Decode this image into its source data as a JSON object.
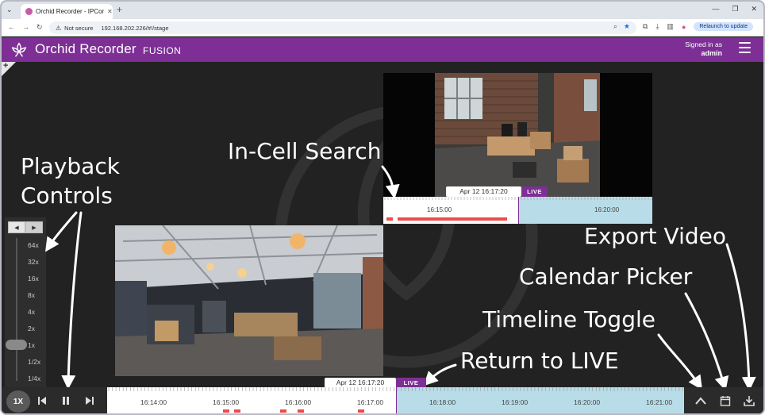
{
  "browser": {
    "tab_title": "Orchid Recorder - IPConfigure",
    "address_warning": "Not secure",
    "url": "192.168.202.226/#!/stage",
    "relaunch_label": "Relaunch to update"
  },
  "header": {
    "app_name": "Orchid Recorder",
    "app_sub": "FUSION",
    "signed_in_label": "Signed in as",
    "username": "admin"
  },
  "annotations": {
    "playback_line1": "Playback",
    "playback_line2": "Controls",
    "in_cell_search": "In-Cell Search",
    "export_video": "Export Video",
    "calendar_picker": "Calendar Picker",
    "timeline_toggle": "Timeline Toggle",
    "return_to_live": "Return to LIVE"
  },
  "speed": {
    "labels": [
      "64x",
      "32x",
      "16x",
      "8x",
      "4x",
      "2x",
      "1x",
      "1/2x",
      "1/4x"
    ],
    "selected": "1x",
    "button_label": "1X"
  },
  "cell1_timeline": {
    "date": "Apr 12 16:17:20",
    "live": "LIVE",
    "ticks": [
      "16:15:00",
      "16:20:00"
    ]
  },
  "main_timeline": {
    "date": "Apr 12 16:17:20",
    "live": "LIVE",
    "ticks": [
      "16:14:00",
      "16:15:00",
      "16:16:00",
      "16:17:00",
      "16:18:00",
      "16:19:00",
      "16:20:00",
      "16:21:00"
    ]
  },
  "icons": {
    "step_back": "step-back-icon",
    "pause": "pause-icon",
    "step_forward": "step-forward-icon",
    "timeline_toggle": "chevron-up-icon",
    "calendar": "calendar-icon",
    "export": "download-icon"
  },
  "colors": {
    "brand": "#7d2f95",
    "future": "#b8dde8",
    "recording": "#ef4b4b"
  }
}
